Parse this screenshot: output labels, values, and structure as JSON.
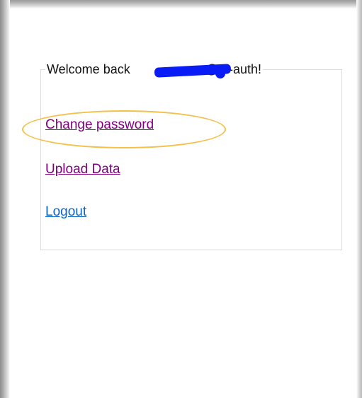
{
  "panel": {
    "welcome_prefix": "Welcome back ",
    "welcome_suffix": "@tu-auth!"
  },
  "links": {
    "change_password": "Change password",
    "upload_data": "Upload Data",
    "logout": "Logout"
  },
  "colors": {
    "visited_link": "#800080",
    "link": "#0a66c2",
    "highlight": "#f5c04a",
    "redaction": "#0a1cf5"
  }
}
